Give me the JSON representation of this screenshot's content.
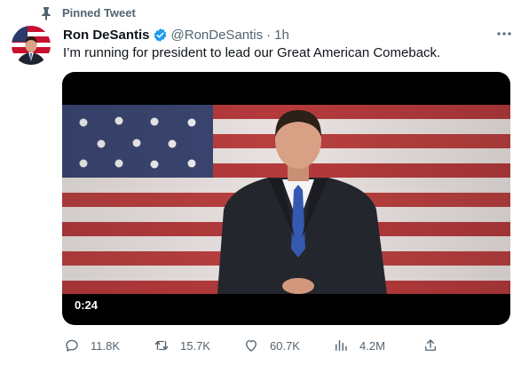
{
  "pinned": {
    "label": "Pinned Tweet",
    "icon": "pin-icon"
  },
  "author": {
    "name": "Ron DeSantis",
    "handle": "@RonDeSantis",
    "separator": "·",
    "time": "1h",
    "verified_color": "#1d9bf0"
  },
  "tweet": {
    "text": "I’m running for president to lead our Great American Comeback."
  },
  "media": {
    "duration": "0:24"
  },
  "actions": {
    "replies": "11.8K",
    "retweets": "15.7K",
    "likes": "60.7K",
    "views": "4.2M"
  },
  "colors": {
    "text": "#0f1419",
    "secondary": "#536471",
    "media_bg": "#000000"
  }
}
